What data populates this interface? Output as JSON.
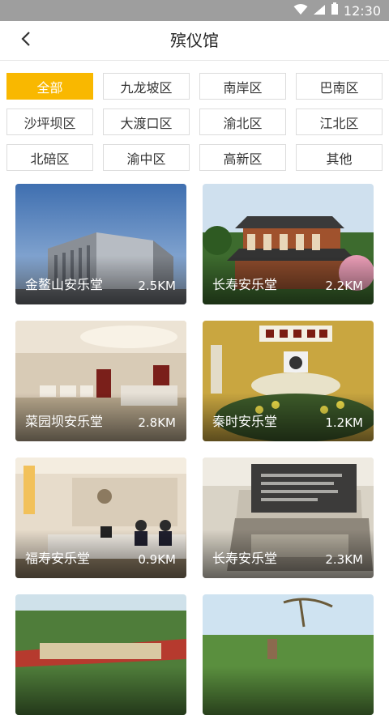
{
  "status": {
    "time": "12:30"
  },
  "header": {
    "title": "殡仪馆"
  },
  "filters": [
    "全部",
    "九龙坡区",
    "南岸区",
    "巴南区",
    "沙坪坝区",
    "大渡口区",
    "渝北区",
    "江北区",
    "北碚区",
    "渝中区",
    "高新区",
    "其他"
  ],
  "cards": [
    {
      "name": "金鳌山安乐堂",
      "distance": "2.5KM"
    },
    {
      "name": "长寿安乐堂",
      "distance": "2.2KM"
    },
    {
      "name": "菜园坝安乐堂",
      "distance": "2.8KM"
    },
    {
      "name": "秦时安乐堂",
      "distance": "1.2KM"
    },
    {
      "name": "福寿安乐堂",
      "distance": "0.9KM"
    },
    {
      "name": "长寿安乐堂",
      "distance": "2.3KM"
    },
    {
      "name": "",
      "distance": ""
    },
    {
      "name": "",
      "distance": ""
    }
  ]
}
